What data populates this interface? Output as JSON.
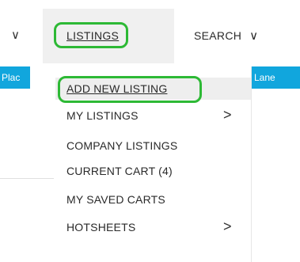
{
  "nav": {
    "left_chevron": "∨",
    "listings_label": "LISTINGS",
    "search_label": "SEARCH",
    "search_chevron": "∨"
  },
  "strips": {
    "left_text": "Plac",
    "right_text": "Lane",
    "color": "#11a6dd"
  },
  "annotation": {
    "color": "#2db935"
  },
  "dropdown": {
    "items": [
      {
        "label": "ADD NEW LISTING",
        "chevron": ""
      },
      {
        "label": "MY LISTINGS",
        "chevron": ">"
      },
      {
        "label": "COMPANY LISTINGS",
        "chevron": ""
      },
      {
        "label": "CURRENT CART (4)",
        "chevron": ""
      },
      {
        "label": "MY SAVED CARTS",
        "chevron": ""
      },
      {
        "label": "HOTSHEETS",
        "chevron": ">"
      }
    ]
  }
}
